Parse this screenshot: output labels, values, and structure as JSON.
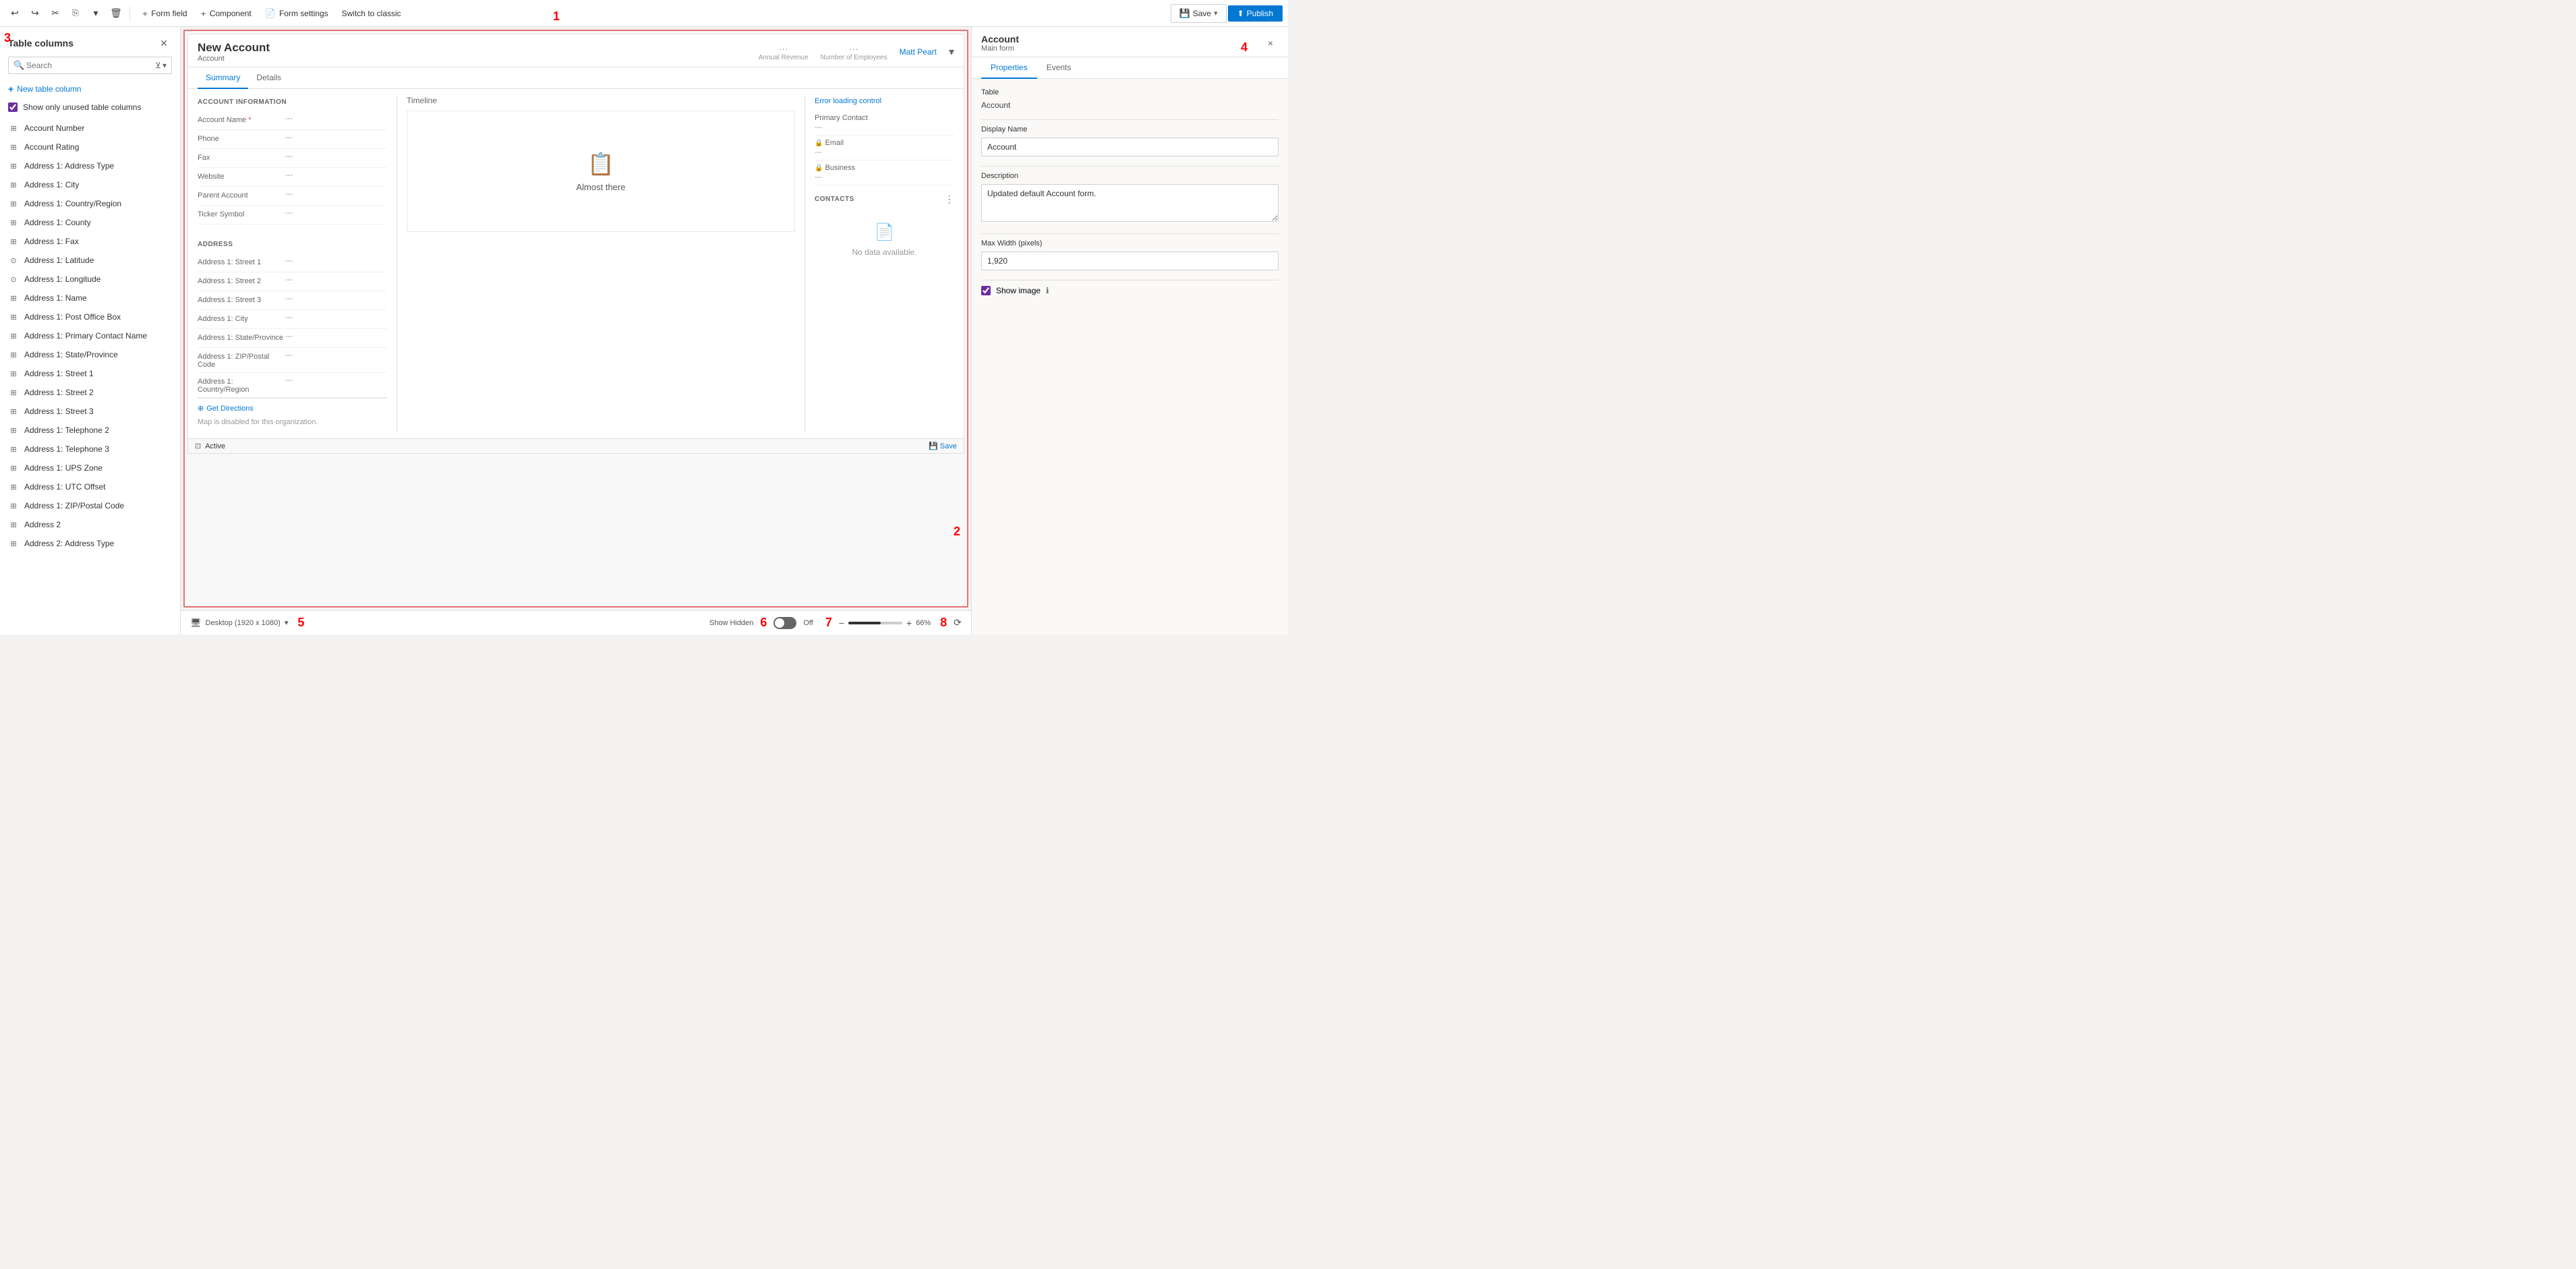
{
  "toolbar": {
    "undo_label": "↩",
    "redo_label": "↪",
    "cut_label": "✂",
    "copy_label": "⎘",
    "paste_label": "📋",
    "dropdown_label": "▾",
    "delete_label": "🗑",
    "form_field_label": "Form field",
    "component_label": "Component",
    "form_settings_label": "Form settings",
    "switch_classic_label": "Switch to classic",
    "save_label": "Save",
    "publish_label": "Publish",
    "label_number": "1"
  },
  "left_panel": {
    "title": "Table columns",
    "search_placeholder": "Search",
    "new_column_label": "New table column",
    "show_unused_label": "Show only unused table columns",
    "show_unused_checked": true,
    "label_number": "3",
    "columns": [
      {
        "id": "account_number",
        "label": "Account Number",
        "icon": "grid"
      },
      {
        "id": "account_rating",
        "label": "Account Rating",
        "icon": "grid"
      },
      {
        "id": "address1_addresstypecode",
        "label": "Address 1: Address Type",
        "icon": "grid"
      },
      {
        "id": "address1_city",
        "label": "Address 1: City",
        "icon": "grid"
      },
      {
        "id": "address1_country",
        "label": "Address 1: Country/Region",
        "icon": "grid"
      },
      {
        "id": "address1_county",
        "label": "Address 1: County",
        "icon": "grid"
      },
      {
        "id": "address1_fax",
        "label": "Address 1: Fax",
        "icon": "grid"
      },
      {
        "id": "address1_latitude",
        "label": "Address 1: Latitude",
        "icon": "circle-dot"
      },
      {
        "id": "address1_longitude",
        "label": "Address 1: Longitude",
        "icon": "circle-dot"
      },
      {
        "id": "address1_name",
        "label": "Address 1: Name",
        "icon": "grid"
      },
      {
        "id": "address1_postofficebox",
        "label": "Address 1: Post Office Box",
        "icon": "grid"
      },
      {
        "id": "address1_primarycontactname",
        "label": "Address 1: Primary Contact Name",
        "icon": "grid"
      },
      {
        "id": "address1_stateorprovince",
        "label": "Address 1: State/Province",
        "icon": "grid"
      },
      {
        "id": "address1_street1",
        "label": "Address 1: Street 1",
        "icon": "grid"
      },
      {
        "id": "address1_street2",
        "label": "Address 1: Street 2",
        "icon": "grid"
      },
      {
        "id": "address1_street3",
        "label": "Address 1: Street 3",
        "icon": "grid"
      },
      {
        "id": "address1_telephone2",
        "label": "Address 1: Telephone 2",
        "icon": "grid"
      },
      {
        "id": "address1_telephone3",
        "label": "Address 1: Telephone 3",
        "icon": "grid"
      },
      {
        "id": "address1_upszone",
        "label": "Address 1: UPS Zone",
        "icon": "grid"
      },
      {
        "id": "address1_utcoffset",
        "label": "Address 1: UTC Offset",
        "icon": "grid"
      },
      {
        "id": "address1_postalcode",
        "label": "Address 1: ZIP/Postal Code",
        "icon": "grid"
      },
      {
        "id": "address2",
        "label": "Address 2",
        "icon": "grid"
      },
      {
        "id": "address2_addresstype",
        "label": "Address 2: Address Type",
        "icon": "grid"
      }
    ]
  },
  "form_canvas": {
    "label_number": "2",
    "form_title": "New Account",
    "form_subtitle": "Account",
    "annual_revenue_label": "Annual Revenue",
    "num_employees_label": "Number of Employees",
    "owner_label": "Matt Peart",
    "tabs": [
      {
        "id": "summary",
        "label": "Summary",
        "active": true
      },
      {
        "id": "details",
        "label": "Details",
        "active": false
      }
    ],
    "account_info": {
      "section_title": "ACCOUNT INFORMATION",
      "fields": [
        {
          "label": "Account Name",
          "value": "---",
          "required": true
        },
        {
          "label": "Phone",
          "value": "---"
        },
        {
          "label": "Fax",
          "value": "---"
        },
        {
          "label": "Website",
          "value": "---"
        },
        {
          "label": "Parent Account",
          "value": "---"
        },
        {
          "label": "Ticker Symbol",
          "value": "---"
        }
      ]
    },
    "timeline": {
      "label": "Timeline",
      "almost_there": "Almost there"
    },
    "right_section": {
      "error_label": "Error loading control",
      "primary_contact_label": "Primary Contact",
      "primary_contact_value": "---",
      "email_label": "Email",
      "email_value": "---",
      "business_label": "Business",
      "business_value": "---",
      "contacts_title": "CONTACTS",
      "no_data_label": "No data available."
    },
    "address": {
      "section_title": "ADDRESS",
      "fields": [
        {
          "label": "Address 1: Street 1",
          "value": "---"
        },
        {
          "label": "Address 1: Street 2",
          "value": "---"
        },
        {
          "label": "Address 1: Street 3",
          "value": "---"
        },
        {
          "label": "Address 1: City",
          "value": "---"
        },
        {
          "label": "Address 1: State/Province",
          "value": "---"
        },
        {
          "label": "Address 1: ZIP/Postal Code",
          "value": "---"
        },
        {
          "label": "Address 1: Country/Region",
          "value": "---"
        }
      ]
    },
    "map": {
      "get_directions_label": "Get Directions",
      "map_disabled_label": "Map is disabled for this organization."
    },
    "status": "Active",
    "save_label": "Save"
  },
  "right_panel": {
    "title": "Account",
    "subtitle": "Main form",
    "label_number": "4",
    "close_label": "×",
    "tabs": [
      {
        "id": "properties",
        "label": "Properties",
        "active": true
      },
      {
        "id": "events",
        "label": "Events",
        "active": false
      }
    ],
    "properties": {
      "table_label": "Table",
      "table_value": "Account",
      "display_name_label": "Display Name",
      "display_name_value": "Account",
      "description_label": "Description",
      "description_value": "Updated default Account form.",
      "max_width_label": "Max Width (pixels)",
      "max_width_value": "1,920",
      "show_image_label": "Show image",
      "show_image_checked": true
    }
  },
  "status_bar": {
    "desktop_label": "Desktop (1920 x 1080)",
    "show_hidden_label": "Show Hidden",
    "off_label": "Off",
    "zoom_percent": "66%",
    "label_numbers": {
      "5": "5",
      "6": "6",
      "7": "7",
      "8": "8"
    }
  }
}
